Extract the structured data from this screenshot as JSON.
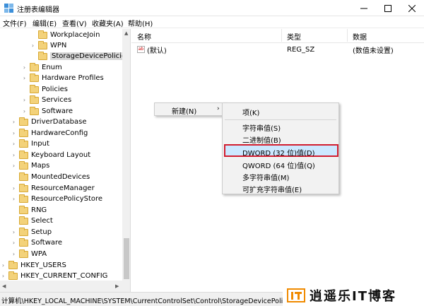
{
  "window": {
    "title": "注册表编辑器"
  },
  "menu": [
    "文件(F)",
    "编辑(E)",
    "查看(V)",
    "收藏夹(A)",
    "帮助(H)"
  ],
  "tree": [
    {
      "label": "WorkplaceJoin",
      "expander": ""
    },
    {
      "label": "WPN",
      "expander": "›"
    },
    {
      "label": "StorageDevicePolicies",
      "expander": ""
    },
    {
      "label": "Enum",
      "expander": "›"
    },
    {
      "label": "Hardware Profiles",
      "expander": "›"
    },
    {
      "label": "Policies",
      "expander": ""
    },
    {
      "label": "Services",
      "expander": "›"
    },
    {
      "label": "Software",
      "expander": "›"
    },
    {
      "label": "DriverDatabase",
      "expander": "›"
    },
    {
      "label": "HardwareConfig",
      "expander": "›"
    },
    {
      "label": "Input",
      "expander": "›"
    },
    {
      "label": "Keyboard Layout",
      "expander": "›"
    },
    {
      "label": "Maps",
      "expander": "›"
    },
    {
      "label": "MountedDevices",
      "expander": ""
    },
    {
      "label": "ResourceManager",
      "expander": "›"
    },
    {
      "label": "ResourcePolicyStore",
      "expander": "›"
    },
    {
      "label": "RNG",
      "expander": ""
    },
    {
      "label": "Select",
      "expander": ""
    },
    {
      "label": "Setup",
      "expander": "›"
    },
    {
      "label": "Software",
      "expander": "›"
    },
    {
      "label": "WPA",
      "expander": "›"
    },
    {
      "label": "HKEY_USERS",
      "expander": "›"
    },
    {
      "label": "HKEY_CURRENT_CONFIG",
      "expander": "›"
    }
  ],
  "columns": {
    "name": "名称",
    "type": "类型",
    "data": "数据"
  },
  "values": [
    {
      "icon": "ab",
      "name": "(默认)",
      "type": "REG_SZ",
      "data": "(数值未设置)"
    }
  ],
  "context_menu": {
    "new_label": "新建(N)",
    "submenu": [
      "项(K)",
      "字符串值(S)",
      "二进制值(B)",
      "DWORD (32 位)值(D)",
      "QWORD (64 位)值(Q)",
      "多字符串值(M)",
      "可扩充字符串值(E)"
    ]
  },
  "status": {
    "path": "计算机\\HKEY_LOCAL_MACHINE\\SYSTEM\\CurrentControlSet\\Control\\StorageDevicePolicies"
  },
  "watermark": {
    "text": "逍遥乐IT博客"
  },
  "colors": {
    "highlight_border": "#d21d2f",
    "highlight_fill": "#cce8ff",
    "folder": "#f3d27a",
    "logo_orange": "#f08a00"
  }
}
